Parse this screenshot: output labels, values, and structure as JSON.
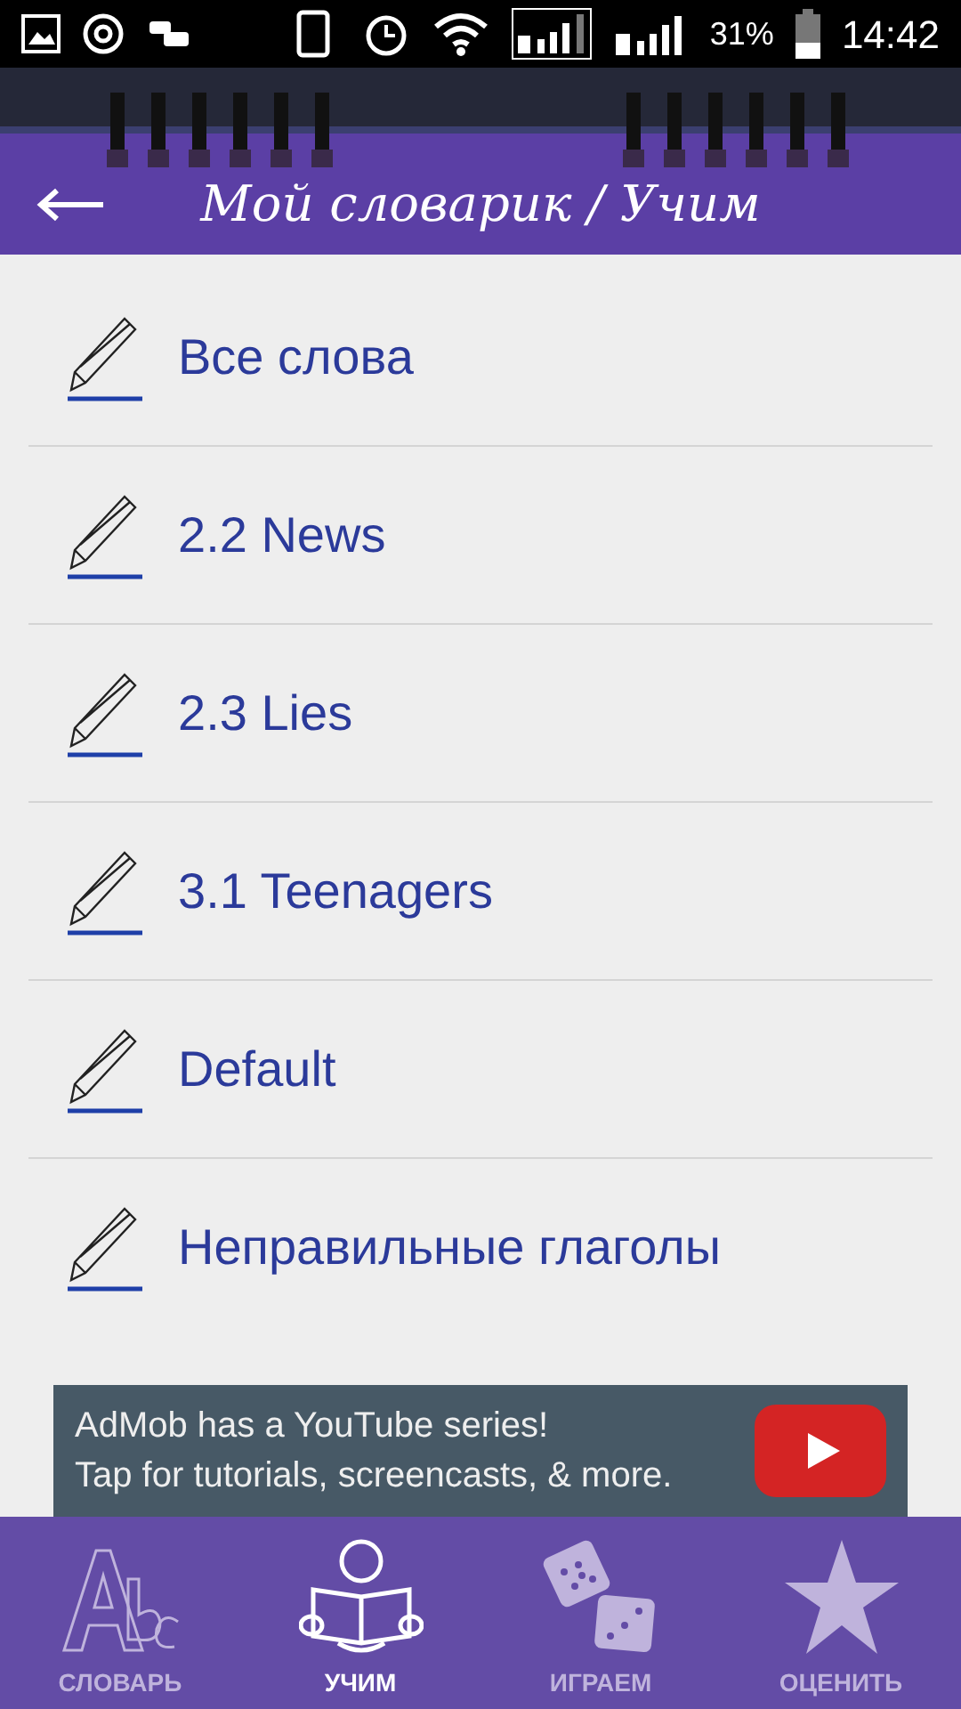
{
  "status_bar": {
    "battery_percent": "31%",
    "time": "14:42"
  },
  "header": {
    "title": "Мой словарик / Учим"
  },
  "lists": [
    {
      "label": "Все слова"
    },
    {
      "label": "2.2 News"
    },
    {
      "label": "2.3 Lies"
    },
    {
      "label": "3.1 Teenagers"
    },
    {
      "label": "Default"
    },
    {
      "label": "Неправильные глаголы"
    }
  ],
  "ad": {
    "line_1": "AdMob has a YouTube series!",
    "line_2": "Tap for tutorials, screencasts, & more."
  },
  "tabs": [
    {
      "kind": "abc",
      "label": "СЛОВАРЬ",
      "selected": false
    },
    {
      "kind": "reader",
      "label": "УЧИМ",
      "selected": true
    },
    {
      "kind": "dice",
      "label": "ИГРАЕМ",
      "selected": false
    },
    {
      "kind": "star",
      "label": "ОЦЕНИТЬ",
      "selected": false
    }
  ]
}
